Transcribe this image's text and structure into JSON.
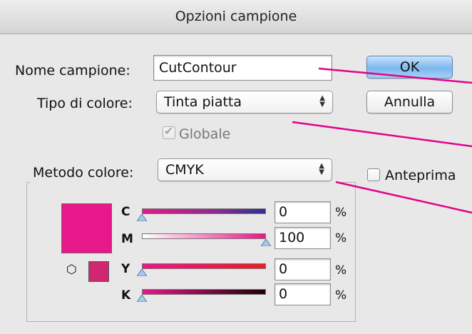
{
  "window": {
    "title": "Opzioni campione"
  },
  "form": {
    "name_label": "Nome campione:",
    "name_value": "CutContour",
    "color_type_label": "Tipo di colore:",
    "color_type_value": "Tinta piatta",
    "global_label": "Globale",
    "global_checked": true,
    "color_mode_label": "Metodo colore:",
    "color_mode_value": "CMYK"
  },
  "buttons": {
    "ok": "OK",
    "cancel": "Annulla"
  },
  "preview": {
    "label": "Anteprima",
    "checked": false
  },
  "swatch_color": "#e8178a",
  "annotation_color": "#e5008a",
  "sliders": [
    {
      "channel": "C",
      "value": "0",
      "unit": "%"
    },
    {
      "channel": "M",
      "value": "100",
      "unit": "%"
    },
    {
      "channel": "Y",
      "value": "0",
      "unit": "%"
    },
    {
      "channel": "K",
      "value": "0",
      "unit": "%"
    }
  ],
  "icons": {
    "gamut": "cube-icon"
  }
}
